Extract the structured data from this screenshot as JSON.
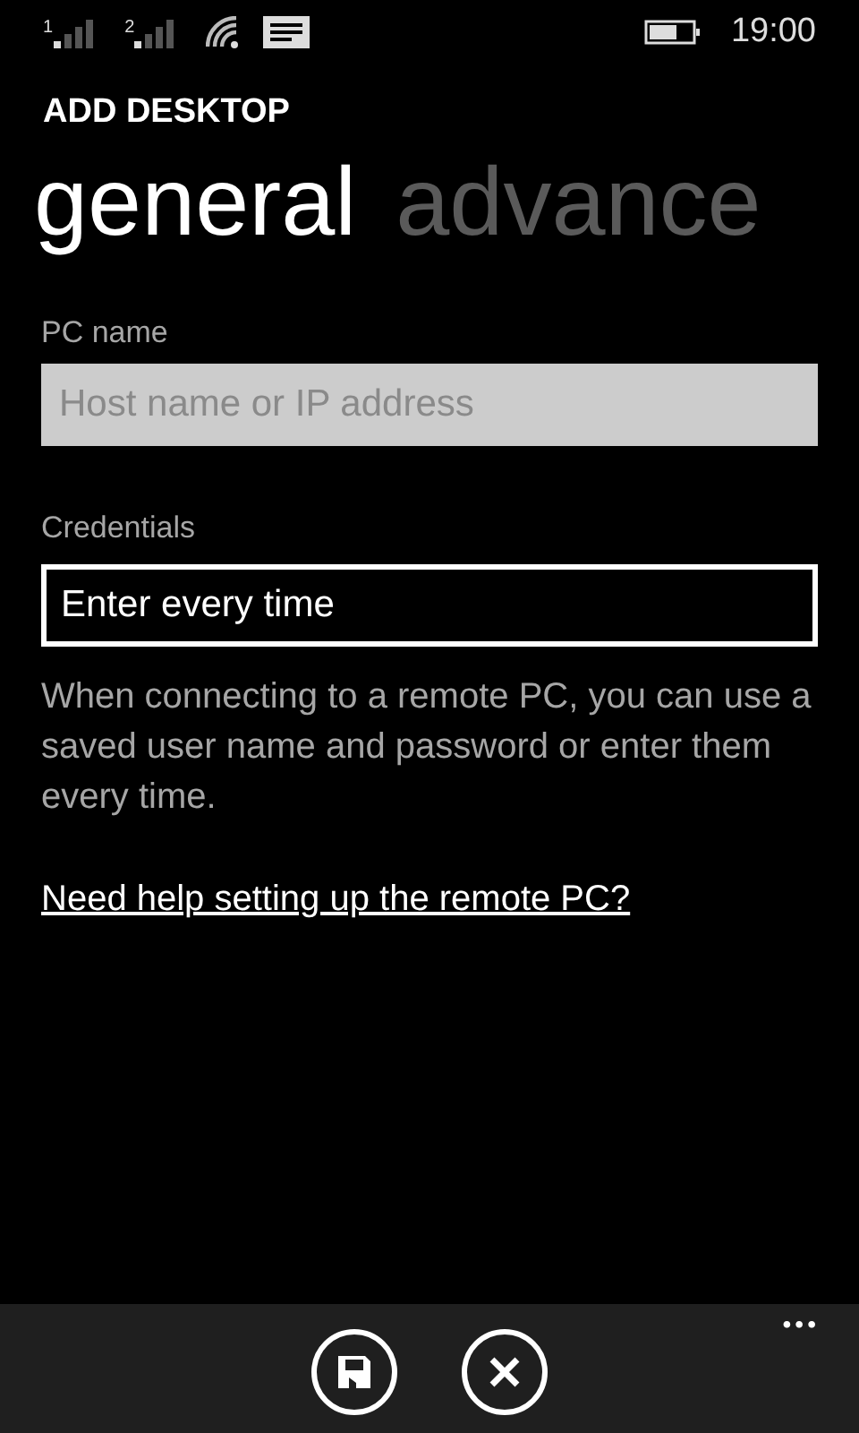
{
  "status_bar": {
    "sims": [
      "1",
      "2"
    ],
    "time": "19:00"
  },
  "app_title": "ADD DESKTOP",
  "pivot": [
    {
      "label": "general",
      "selected": true
    },
    {
      "label": "advance",
      "selected": false
    }
  ],
  "pc_name": {
    "label": "PC name",
    "placeholder": "Host name or IP address"
  },
  "credentials": {
    "label": "Credentials",
    "value": "Enter every time"
  },
  "description": "When connecting to a remote PC, you can use a saved user name and password or enter them every time.",
  "help_link": "Need help setting up the remote PC?",
  "app_bar": {
    "buttons": [
      {
        "kind": "save"
      },
      {
        "kind": "cancel"
      }
    ],
    "more": "•••"
  }
}
